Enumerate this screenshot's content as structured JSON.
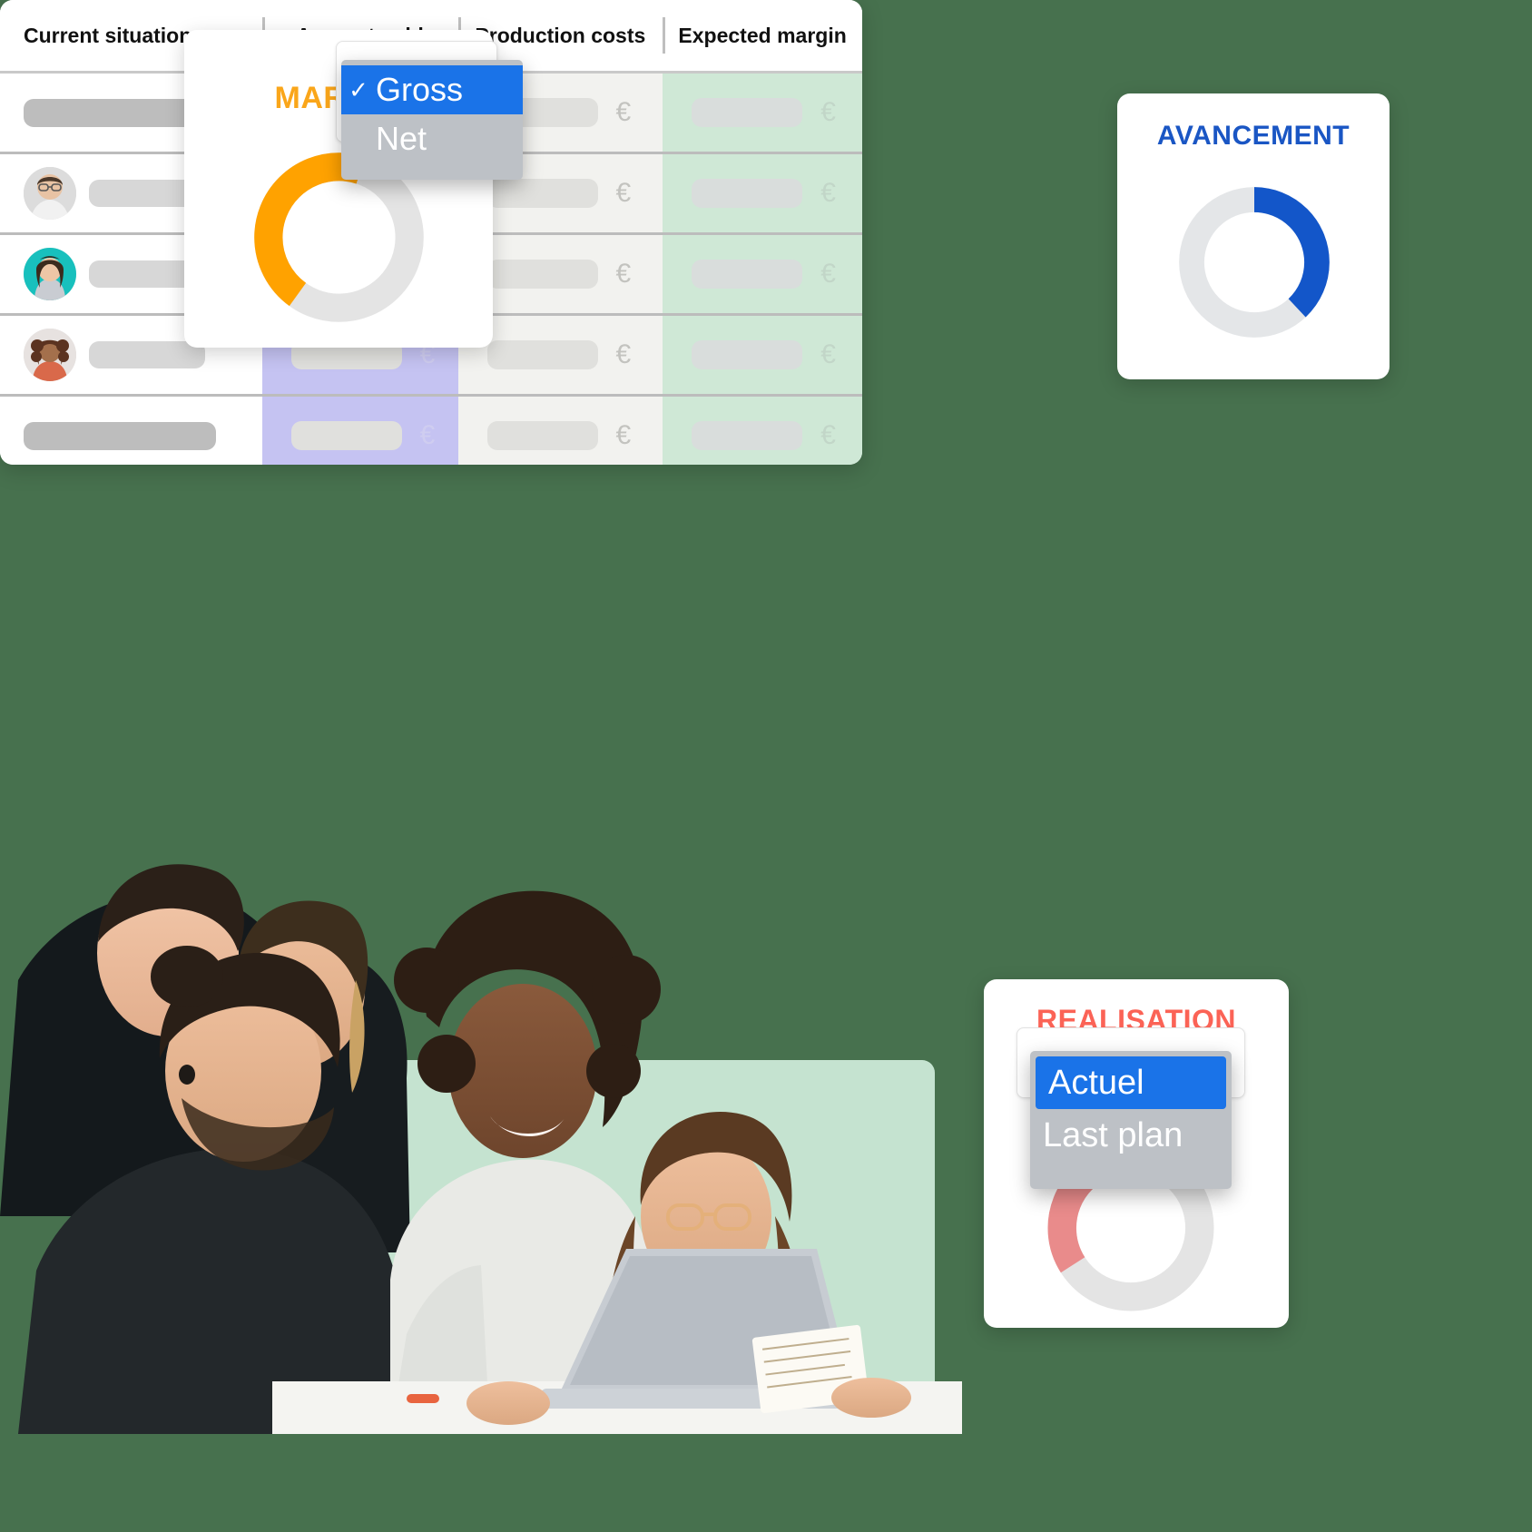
{
  "background": {
    "color": "#47714e"
  },
  "cards": {
    "margin": {
      "title": "MARGIN",
      "accent": "#faa61a",
      "dropdown": {
        "options": [
          {
            "label": "Gross",
            "selected": true,
            "check": "✓"
          },
          {
            "label": "Net",
            "selected": false,
            "check": "✓"
          }
        ]
      },
      "donut": {
        "value": 45,
        "color": "#ffa200",
        "track": "#e4e4e4"
      }
    },
    "avancement": {
      "title": "AVANCEMENT",
      "accent": "#1a56c4",
      "donut": {
        "value": 38,
        "color": "#1356c9",
        "track": "#e4e6e8"
      }
    },
    "realisation": {
      "title": "REALISATION",
      "accent": "#fb6356",
      "dropdown": {
        "options": [
          {
            "label": "Actuel",
            "selected": true
          },
          {
            "label": "Last plan",
            "selected": false
          }
        ]
      },
      "donut": {
        "value": 42,
        "color": "#e98b8b",
        "track": "#e4e4e4"
      }
    }
  },
  "table": {
    "columns": [
      {
        "label": "Current situation",
        "key": "situation"
      },
      {
        "label": "Amount sold",
        "key": "amount_sold"
      },
      {
        "label": "Production costs",
        "key": "production_costs"
      },
      {
        "label": "Expected margin",
        "key": "expected_margin"
      }
    ],
    "currency_symbol": "€",
    "column_colors": {
      "situation": "#ffffff",
      "amount_sold": "#c5c3f2",
      "production_costs": "#f2f2ef",
      "expected_margin": "#cfe8d6"
    },
    "rows": [
      {
        "type": "summary",
        "avatar": null,
        "label_placeholder": true
      },
      {
        "type": "person",
        "avatar": "avatar-man-glasses",
        "label_placeholder": true
      },
      {
        "type": "person",
        "avatar": "avatar-woman-teal",
        "label_placeholder": true
      },
      {
        "type": "person",
        "avatar": "avatar-woman-curly",
        "label_placeholder": true
      },
      {
        "type": "summary",
        "avatar": null,
        "label_placeholder": true
      }
    ]
  },
  "photo": {
    "alt": "team-collaborating-around-laptop",
    "accent_rect_color": "#c5e3d0"
  }
}
